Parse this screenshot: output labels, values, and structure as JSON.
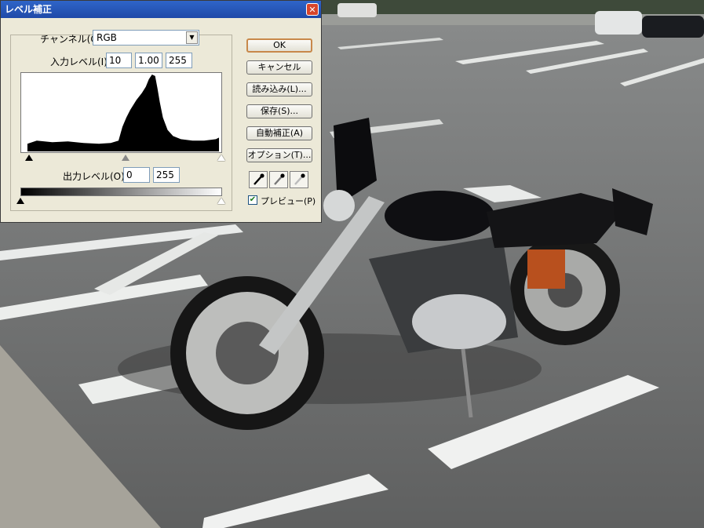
{
  "dialog": {
    "title": "レベル補正",
    "close_icon": "close-icon",
    "channel_label": "チャンネル(C):",
    "channel_value": "RGB",
    "input_levels_label": "入力レベル(I):",
    "input_black": "10",
    "input_gamma": "1.00",
    "input_white": "255",
    "output_levels_label": "出力レベル(O):",
    "output_black": "0",
    "output_white": "255",
    "preview_label": "プレビュー(P)",
    "preview_checked": true
  },
  "buttons": {
    "ok": "OK",
    "cancel": "キャンセル",
    "load": "読み込み(L)...",
    "save": "保存(S)...",
    "auto": "自動補正(A)",
    "options": "オプション(T)..."
  },
  "eyedroppers": [
    "black-eyedropper-icon",
    "gray-eyedropper-icon",
    "white-eyedropper-icon"
  ]
}
